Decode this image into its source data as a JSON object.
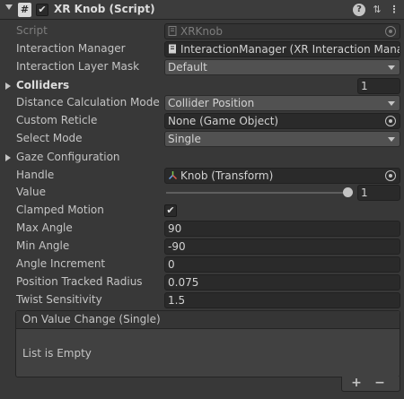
{
  "header": {
    "title": "XR Knob (Script)",
    "script_icon": "#",
    "enabled_check": "✔",
    "help_icon": "?",
    "preset_icon": "⇅",
    "menu_icon": "⋮"
  },
  "fields": {
    "script": {
      "label": "Script",
      "value": "XRKnob"
    },
    "interaction_manager": {
      "label": "Interaction Manager",
      "value": "InteractionManager (XR Interaction Mana"
    },
    "interaction_layer_mask": {
      "label": "Interaction Layer Mask",
      "value": "Default"
    },
    "colliders": {
      "label": "Colliders",
      "count": "1"
    },
    "distance_calc_mode": {
      "label": "Distance Calculation Mode",
      "value": "Collider Position"
    },
    "custom_reticle": {
      "label": "Custom Reticle",
      "value": "None (Game Object)"
    },
    "select_mode": {
      "label": "Select Mode",
      "value": "Single"
    },
    "gaze_configuration": {
      "label": "Gaze Configuration"
    },
    "handle": {
      "label": "Handle",
      "value": "Knob (Transform)"
    },
    "value": {
      "label": "Value",
      "value": "1",
      "slider_fraction": 1.0
    },
    "clamped_motion": {
      "label": "Clamped Motion",
      "check": "✔"
    },
    "max_angle": {
      "label": "Max Angle",
      "value": "90"
    },
    "min_angle": {
      "label": "Min Angle",
      "value": "-90"
    },
    "angle_increment": {
      "label": "Angle Increment",
      "value": "0"
    },
    "position_tracked_radius": {
      "label": "Position Tracked Radius",
      "value": "0.075"
    },
    "twist_sensitivity": {
      "label": "Twist Sensitivity",
      "value": "1.5"
    }
  },
  "event": {
    "title": "On Value Change (Single)",
    "empty_text": "List is Empty",
    "add_label": "+",
    "remove_label": "−"
  },
  "colors": {
    "background": "#383838",
    "field": "#2a2a2a",
    "dropdown": "#515151",
    "text": "#c4c4c4"
  }
}
